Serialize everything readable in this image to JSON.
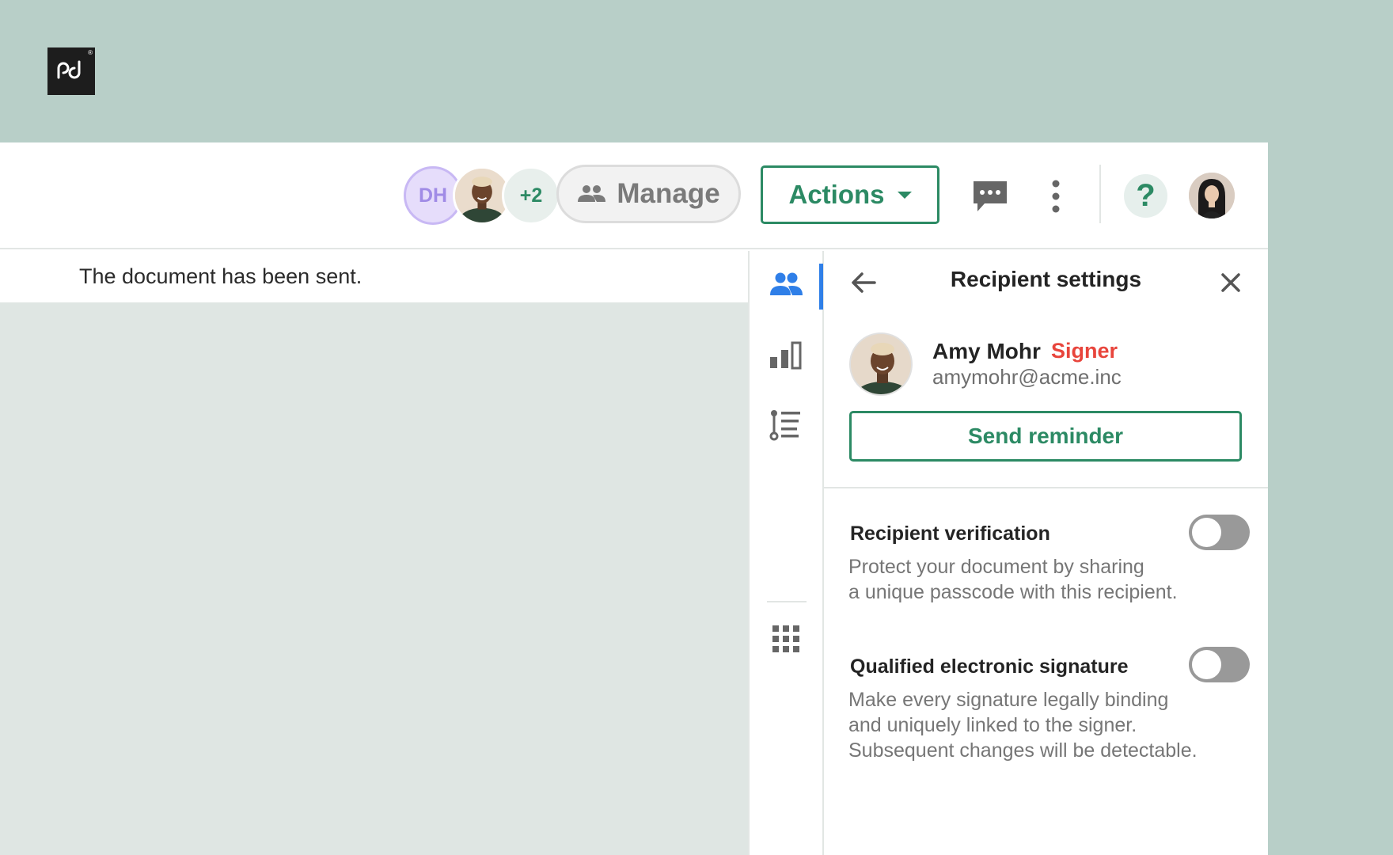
{
  "brand": {
    "logo_text": "pd",
    "accent": "#2c8a64",
    "background": "#b8cfc8"
  },
  "header": {
    "collaborators": [
      {
        "initials": "DH",
        "type": "initials"
      },
      {
        "type": "photo",
        "name": "Amy Mohr"
      },
      {
        "label": "+2",
        "type": "overflow"
      }
    ],
    "manage_label": "Manage",
    "actions_label": "Actions",
    "icons": [
      "people-icon",
      "caret-down-icon",
      "chat-icon",
      "more-vertical-icon",
      "help-icon",
      "user-avatar"
    ],
    "help_label": "?"
  },
  "status": {
    "message": "The document has been sent."
  },
  "rail": {
    "items": [
      {
        "icon": "recipients-icon",
        "active": true
      },
      {
        "icon": "analytics-icon",
        "active": false
      },
      {
        "icon": "fields-list-icon",
        "active": false
      },
      {
        "icon": "apps-grid-icon",
        "active": false
      }
    ]
  },
  "panel": {
    "title": "Recipient settings",
    "recipient": {
      "name": "Amy Mohr",
      "role": "Signer",
      "email": "amymohr@acme.inc"
    },
    "reminder_label": "Send reminder",
    "settings": [
      {
        "label": "Recipient verification",
        "description_lines": [
          "Protect your document by sharing",
          "a unique passcode with this recipient."
        ],
        "enabled": false
      },
      {
        "label": "Qualified electronic signature",
        "description_lines": [
          "Make every signature legally binding",
          "and uniquely linked to the signer.",
          "Subsequent changes will be detectable."
        ],
        "enabled": false
      }
    ]
  }
}
